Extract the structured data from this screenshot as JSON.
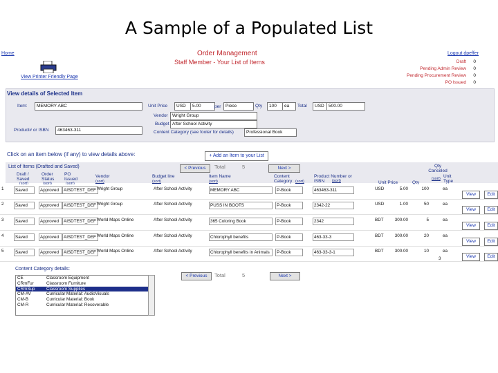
{
  "slide": {
    "title": "A Sample of a Populated List"
  },
  "nav": {
    "home": "Home",
    "logout": "Logout dpeffer",
    "printer_friendly": "View Printer Friendly Page"
  },
  "header": {
    "title": "Order Management",
    "subtitle": "Staff Member - Your List of Items"
  },
  "counts": [
    {
      "label": "Draft",
      "value": "0"
    },
    {
      "label": "Pending Admin Review",
      "value": "0"
    },
    {
      "label": "Pending Procurement Review",
      "value": "0"
    },
    {
      "label": "PO Issued",
      "value": "0"
    }
  ],
  "details": {
    "heading": "View details of Selected Item",
    "item_label": "Item:",
    "item_value": "MEMORY ABC",
    "product_label": "Product# or ISBN",
    "product_value": "463463-311",
    "unit_price_label": "Unit Price",
    "currency": "USD",
    "unit_price": "5.00",
    "per_label": "per",
    "per_value": "Piece",
    "qty_label": "Qty",
    "qty_value": "100",
    "qty_unit": "ea",
    "total_label": "Total",
    "total_currency": "USD",
    "total_value": "500.00",
    "vendor_label": "Vendor",
    "vendor_value": "Wright Group",
    "budget_label": "Budget",
    "budget_value": "After School Activity",
    "category_label": "Content Category (see footer for details)",
    "category_value": "Professional Book"
  },
  "instructions": "Click on an item below (if any) to view details above:",
  "add_button": "+ Add an Item to your List",
  "list": {
    "heading": "List of Items (Drafted and Saved)",
    "prev": "< Previous",
    "next": "Next >",
    "total_label": "Total",
    "total_value": "5",
    "qty_canceled": "Qty Canceled",
    "columns": {
      "status": "Draft / Saved",
      "order_status": "Order Status",
      "po_issued": "PO Issued",
      "vendor": "Vendor",
      "budget": "Budget line",
      "item": "Item Name",
      "category": "Content Category",
      "product": "Product Number or ISBN",
      "unit_price": "Unit Price",
      "qty": "Qty",
      "unit_type": "Unit Type",
      "sort": "(sort)"
    },
    "view_label": "View",
    "edit_label": "Edit",
    "rows": [
      {
        "n": "1",
        "saved": "Saved",
        "status": "Approved",
        "po": "AISDTEST_DEF",
        "vendor": "Wright Group",
        "budget": "After School Activity",
        "item": "MEMORY ABC",
        "cat": "P-Book",
        "product": "463463-311",
        "cur": "USD",
        "price": "5.00",
        "qty": "100",
        "unit": "ea",
        "cancel": ""
      },
      {
        "n": "2",
        "saved": "Saved",
        "status": "Approved",
        "po": "AISDTEST_DEF",
        "vendor": "Wright Group",
        "budget": "After School Activity",
        "item": "PUSS IN BOOTS",
        "cat": "P-Book",
        "product": "2342-22",
        "cur": "USD",
        "price": "1.00",
        "qty": "50",
        "unit": "ea",
        "cancel": ""
      },
      {
        "n": "3",
        "saved": "Saved",
        "status": "Approved",
        "po": "AISDTEST_DEF",
        "vendor": "World Maps Online",
        "budget": "After School Activity",
        "item": "365 Coloring Book",
        "cat": "P-Book",
        "product": "2342",
        "cur": "BDT",
        "price": "300.00",
        "qty": "5",
        "unit": "ea",
        "cancel": ""
      },
      {
        "n": "4",
        "saved": "Saved",
        "status": "Approved",
        "po": "AISDTEST_DEF",
        "vendor": "World Maps Online",
        "budget": "After School Activity",
        "item": "Chlorophyll benefits",
        "cat": "P-Book",
        "product": "463-33-3",
        "cur": "BDT",
        "price": "300.00",
        "qty": "20",
        "unit": "ea",
        "cancel": ""
      },
      {
        "n": "5",
        "saved": "Saved",
        "status": "Approved",
        "po": "AISDTEST_DEF",
        "vendor": "World Maps Online",
        "budget": "After School Activity",
        "item": "Chlorophyll benefits in Animals",
        "cat": "P-Book",
        "product": "463-33-3-1",
        "cur": "BDT",
        "price": "300.00",
        "qty": "10",
        "unit": "ea",
        "cancel": "3"
      }
    ]
  },
  "category_details": {
    "heading": "Content Category details:",
    "items": [
      {
        "code": "CE",
        "name": "Classroom Equipment"
      },
      {
        "code": "CRmFur",
        "name": "Classroom Furniture"
      },
      {
        "code": "CRmSup",
        "name": "Classroom Supplies"
      },
      {
        "code": "CM-AV",
        "name": "Curricular Material: AudioVisuals"
      },
      {
        "code": "CM-B",
        "name": "Curricular Material: Book"
      },
      {
        "code": "CM-R",
        "name": "Curricular Material: Recoverable"
      }
    ]
  },
  "colors": {
    "header_red": "#c0262c",
    "link_blue": "#1a37b0",
    "panel_gray": "#e9e9ef"
  }
}
